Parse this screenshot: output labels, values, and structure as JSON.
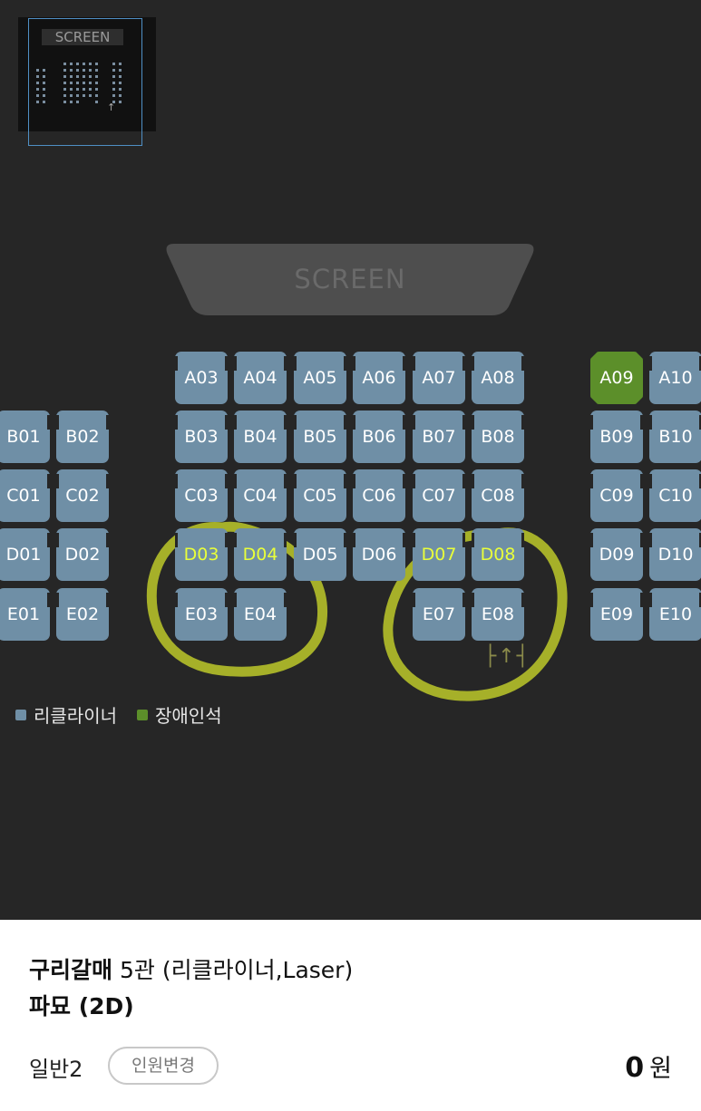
{
  "minimap": {
    "screen_label": "SCREEN",
    "arrow": "↑"
  },
  "screen": {
    "label": "SCREEN"
  },
  "seats": {
    "A03": "A03",
    "A04": "A04",
    "A05": "A05",
    "A06": "A06",
    "A07": "A07",
    "A08": "A08",
    "A09": "A09",
    "A10": "A10",
    "B01": "B01",
    "B02": "B02",
    "B03": "B03",
    "B04": "B04",
    "B05": "B05",
    "B06": "B06",
    "B07": "B07",
    "B08": "B08",
    "B09": "B09",
    "B10": "B10",
    "C01": "C01",
    "C02": "C02",
    "C03": "C03",
    "C04": "C04",
    "C05": "C05",
    "C06": "C06",
    "C07": "C07",
    "C08": "C08",
    "C09": "C09",
    "C10": "C10",
    "D01": "D01",
    "D02": "D02",
    "D03": "D03",
    "D04": "D04",
    "D05": "D05",
    "D06": "D06",
    "D07": "D07",
    "D08": "D08",
    "D09": "D09",
    "D10": "D10",
    "E01": "E01",
    "E02": "E02",
    "E03": "E03",
    "E04": "E04",
    "E07": "E07",
    "E08": "E08",
    "E09": "E09",
    "E10": "E10"
  },
  "exit_marker": "├↑┤",
  "legend": [
    {
      "label": "리클라이너",
      "color": "#6f8fa6"
    },
    {
      "label": "장애인석",
      "color": "#5c8f2a"
    }
  ],
  "colors": {
    "seat": "#6f8fa6",
    "accessible": "#5c8f2a",
    "highlight_text": "#e9ff3a",
    "annotation": "#c7d32a"
  },
  "panel": {
    "theater_name": "구리갈매",
    "theater_detail": " 5관 (리클라이너,Laser)",
    "movie": "파묘 (2D)",
    "person_type": "일반2",
    "change_button": "인원변경",
    "price_value": "0",
    "price_unit": "원"
  }
}
